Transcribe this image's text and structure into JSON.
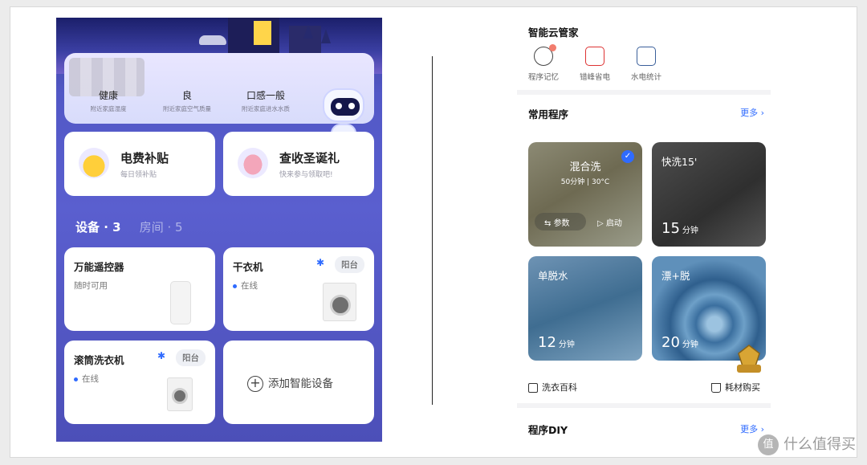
{
  "left_app": {
    "environment": [
      {
        "value": "健康",
        "note": "附近家庭湿度"
      },
      {
        "value": "良",
        "note": "附近家庭空气质量"
      },
      {
        "value": "口感一般",
        "note": "附近家庭进水水质"
      }
    ],
    "promos": [
      {
        "title": "电费补贴",
        "subtitle": "每日领补贴",
        "icon": "piggy-bank-icon",
        "color": "#ffd24a"
      },
      {
        "title": "查收圣诞礼",
        "subtitle": "快来参与领取吧!",
        "icon": "christmas-egg-icon",
        "color": "#f5a3b7"
      }
    ],
    "tabs": [
      {
        "label": "设备 · 3",
        "active": true
      },
      {
        "label": "房间 · 5",
        "active": false
      }
    ],
    "devices": [
      {
        "name": "万能遥控器",
        "status": "随时可用",
        "room": "",
        "bluetooth": false
      },
      {
        "name": "干衣机",
        "status": "在线",
        "room": "阳台",
        "bluetooth": true
      },
      {
        "name": "滚筒洗衣机",
        "status": "在线",
        "room": "阳台",
        "bluetooth": true
      }
    ],
    "add_device_label": "添加智能设备",
    "bluetooth_glyph": "✱"
  },
  "right_app": {
    "title": "智能云管家",
    "features": [
      {
        "label": "程序记忆",
        "icon": "brain-icon"
      },
      {
        "label": "错峰省电",
        "icon": "calendar-bolt-icon"
      },
      {
        "label": "水电统计",
        "icon": "stats-icon"
      }
    ],
    "common_programs_title": "常用程序",
    "more_label": "更多",
    "programs": [
      {
        "name": "混合洗",
        "meta": "50分钟 | 30°C",
        "selected": true,
        "params_label": "参数",
        "start_label": "启动"
      },
      {
        "name": "快洗15'",
        "minutes": "15",
        "unit": "分钟"
      },
      {
        "name": "单脱水",
        "minutes": "12",
        "unit": "分钟"
      },
      {
        "name": "漂+脱",
        "minutes": "20",
        "unit": "分钟"
      }
    ],
    "footer_links": [
      "洗衣百科",
      "耗材购买"
    ],
    "diy_title": "程序DIY",
    "diy_more": "更多"
  },
  "watermark": {
    "glyph": "值",
    "text": "什么值得买"
  },
  "colors": {
    "accent": "#2f6bff",
    "left_bg": "#5a5fcf"
  }
}
